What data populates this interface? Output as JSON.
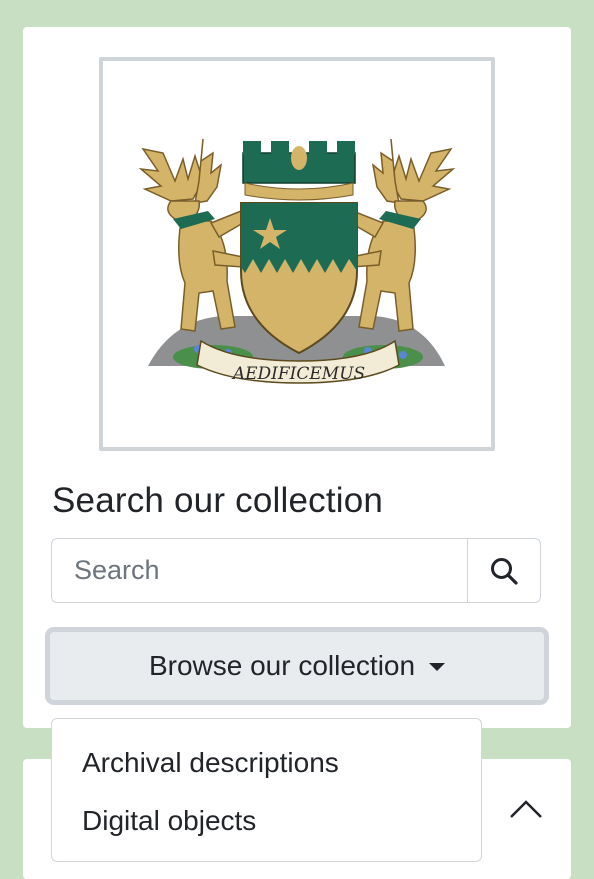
{
  "logo": {
    "motto": "AEDIFICEMUS",
    "colors": {
      "green": "#1e6b54",
      "gold": "#d4b468",
      "frame": "#cfd4d9"
    }
  },
  "search": {
    "heading": "Search our collection",
    "placeholder": "Search",
    "submit_icon": "search-icon"
  },
  "browse": {
    "label": "Browse our collection",
    "menu_items": [
      {
        "label": "Archival descriptions"
      },
      {
        "label": "Digital objects"
      }
    ]
  },
  "second_card": {
    "toggle_icon": "chevron-up-icon"
  },
  "colors": {
    "page_bg": "#c9dfc3",
    "card_bg": "#ffffff",
    "button_bg": "#e9ecef",
    "border": "#ced4da"
  }
}
